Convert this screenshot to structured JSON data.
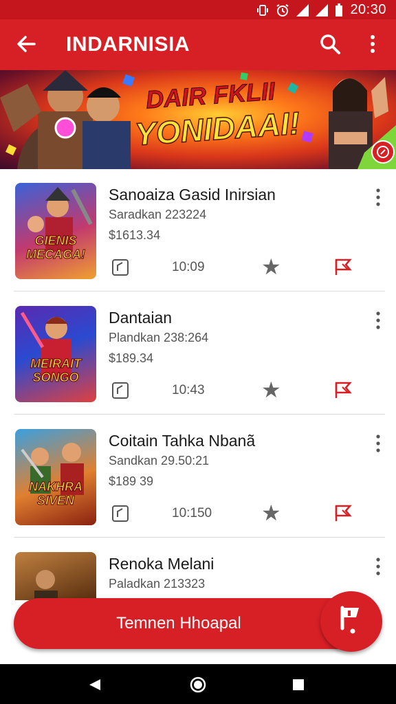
{
  "status_bar": {
    "time": "20:30"
  },
  "app_bar": {
    "title": "INDARNISIA"
  },
  "banner": {
    "line1": "DAIR FKLII",
    "line2": "YONIDAAI!"
  },
  "items": [
    {
      "name": "Sanoaiza Gasid Inirsian",
      "subtitle": "Saradkan 223224",
      "price": "$1613.34",
      "time": "10:09",
      "thumb_text": "GIENIS MECAGA!"
    },
    {
      "name": "Dantaian",
      "subtitle": "Plandkan 238:264",
      "price": "$189.34",
      "time": "10:43",
      "thumb_text": "MEIRAIT SONGO"
    },
    {
      "name": "Coitain Tahka Nbanã",
      "subtitle": "Sandkan 29.50:21",
      "price": "$189 39",
      "time": "10:150",
      "thumb_text": "NAKHRA SIVEN"
    },
    {
      "name": "Renoka Melani",
      "subtitle": "Paladkan 213323",
      "price": "",
      "time": "",
      "thumb_text": ""
    }
  ],
  "bottom_button": {
    "label": "Temnen Hhoapal"
  },
  "colors": {
    "primary": "#d71f26",
    "status_bar": "#c4161c"
  }
}
